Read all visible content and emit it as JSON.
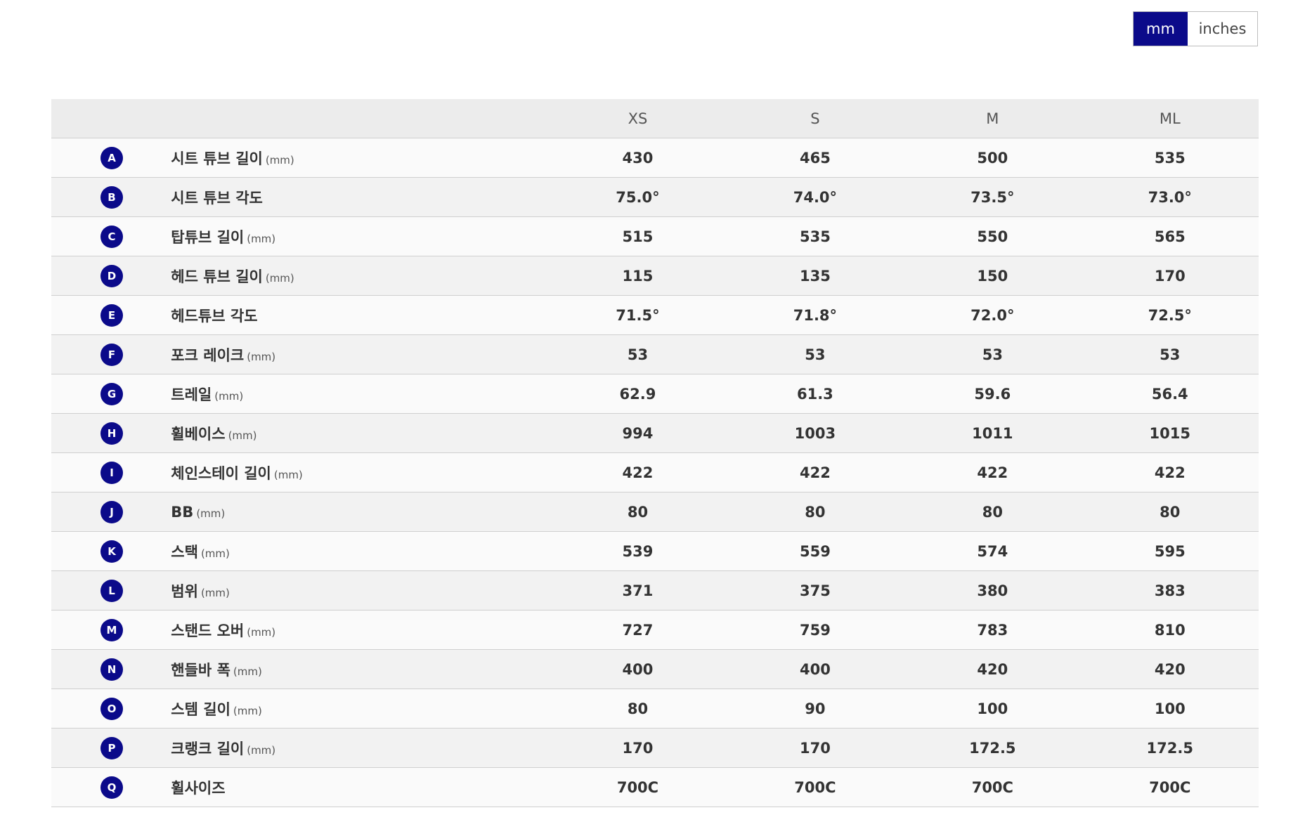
{
  "unit_toggle": {
    "options": [
      "mm",
      "inches"
    ],
    "selected": "mm"
  },
  "table": {
    "sizes": [
      "XS",
      "S",
      "M",
      "ML"
    ],
    "rows": [
      {
        "letter": "A",
        "label": "시트 튜브 길이",
        "unit": "(mm)",
        "values": [
          "430",
          "465",
          "500",
          "535"
        ]
      },
      {
        "letter": "B",
        "label": "시트 튜브 각도",
        "unit": "",
        "values": [
          "75.0°",
          "74.0°",
          "73.5°",
          "73.0°"
        ]
      },
      {
        "letter": "C",
        "label": "탑튜브 길이",
        "unit": "(mm)",
        "values": [
          "515",
          "535",
          "550",
          "565"
        ]
      },
      {
        "letter": "D",
        "label": "헤드 튜브 길이",
        "unit": "(mm)",
        "values": [
          "115",
          "135",
          "150",
          "170"
        ]
      },
      {
        "letter": "E",
        "label": "헤드튜브 각도",
        "unit": "",
        "values": [
          "71.5°",
          "71.8°",
          "72.0°",
          "72.5°"
        ]
      },
      {
        "letter": "F",
        "label": "포크 레이크",
        "unit": "(mm)",
        "values": [
          "53",
          "53",
          "53",
          "53"
        ]
      },
      {
        "letter": "G",
        "label": "트레일",
        "unit": "(mm)",
        "values": [
          "62.9",
          "61.3",
          "59.6",
          "56.4"
        ]
      },
      {
        "letter": "H",
        "label": "휠베이스",
        "unit": "(mm)",
        "values": [
          "994",
          "1003",
          "1011",
          "1015"
        ]
      },
      {
        "letter": "I",
        "label": "체인스테이 길이",
        "unit": "(mm)",
        "values": [
          "422",
          "422",
          "422",
          "422"
        ]
      },
      {
        "letter": "J",
        "label": "BB",
        "unit": "(mm)",
        "values": [
          "80",
          "80",
          "80",
          "80"
        ]
      },
      {
        "letter": "K",
        "label": "스택",
        "unit": "(mm)",
        "values": [
          "539",
          "559",
          "574",
          "595"
        ]
      },
      {
        "letter": "L",
        "label": "범위",
        "unit": "(mm)",
        "values": [
          "371",
          "375",
          "380",
          "383"
        ]
      },
      {
        "letter": "M",
        "label": "스탠드 오버",
        "unit": "(mm)",
        "values": [
          "727",
          "759",
          "783",
          "810"
        ]
      },
      {
        "letter": "N",
        "label": "핸들바 폭",
        "unit": "(mm)",
        "values": [
          "400",
          "400",
          "420",
          "420"
        ]
      },
      {
        "letter": "O",
        "label": "스템 길이",
        "unit": "(mm)",
        "values": [
          "80",
          "90",
          "100",
          "100"
        ]
      },
      {
        "letter": "P",
        "label": "크랭크 길이",
        "unit": "(mm)",
        "values": [
          "170",
          "170",
          "172.5",
          "172.5"
        ]
      },
      {
        "letter": "Q",
        "label": "휠사이즈",
        "unit": "",
        "values": [
          "700C",
          "700C",
          "700C",
          "700C"
        ]
      }
    ]
  },
  "colors": {
    "accent": "#0b0a8a",
    "header_bg": "#ececec",
    "row_alt_bg": "#f2f2f2",
    "divider": "#cfcfcf"
  }
}
